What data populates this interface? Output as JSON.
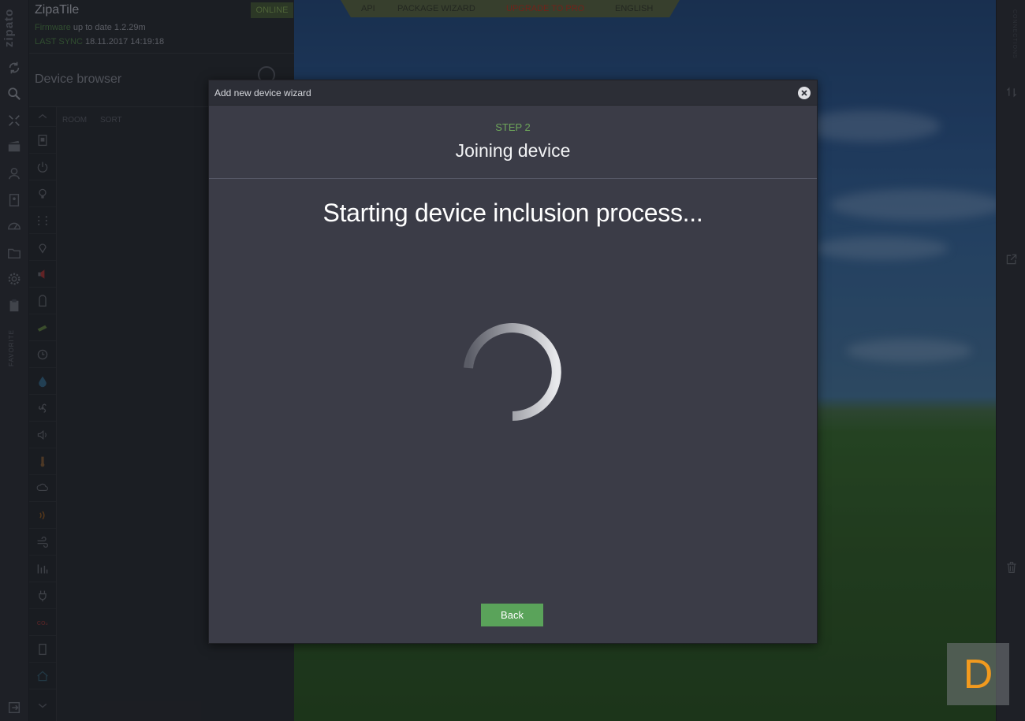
{
  "app": {
    "logo_text": "zipato",
    "title": "ZipaTile",
    "status_badge": "ONLINE",
    "firmware_label": "Firmware",
    "firmware_value": "up to date 1.2.29m",
    "last_sync_label": "LAST SYNC",
    "last_sync_value": "18.11.2017 14:19:18"
  },
  "left_rail": {
    "favorite_label": "FAVORITE",
    "icons": [
      "sync-icon",
      "search-icon",
      "expand-icon",
      "scenes-icon",
      "users-icon",
      "contacts-icon",
      "dashboard-icon",
      "folder-icon",
      "settings-icon",
      "clipboard-icon"
    ],
    "bottom_icon": "exit-icon"
  },
  "device_browser": {
    "title": "Device browser",
    "tabs": [
      "ROOM",
      "SORT"
    ],
    "categories": [
      "up-arrow-icon",
      "tablet-icon",
      "power-icon",
      "bulb-icon",
      "grid-icon",
      "location-icon",
      "speaker-red-icon",
      "door-icon",
      "camera-icon",
      "clock-icon",
      "water-drop-icon",
      "fan-icon",
      "volume-icon",
      "thermometer-icon",
      "weather-icon",
      "signal-icon",
      "wind-icon",
      "meter-icon",
      "plug-icon",
      "co2-icon",
      "phone-icon",
      "home-icon",
      "down-arrow-icon"
    ]
  },
  "top_nav": {
    "items": [
      "API",
      "PACKAGE WIZARD",
      "UPGRADE TO PRO",
      "ENGLISH"
    ],
    "accent_color": "#a22a1a"
  },
  "right_rail": {
    "header_text": "CONNECTIONS",
    "icons": [
      "swap-arrows-icon",
      "external-link-icon",
      "trash-icon"
    ]
  },
  "modal": {
    "title": "Add new device wizard",
    "step_label": "STEP 2",
    "step_title": "Joining device",
    "status_message": "Starting device inclusion process...",
    "back_label": "Back",
    "accent_green": "#5aa35a"
  },
  "badge": {
    "letter": "D",
    "color": "#f29a1e"
  }
}
